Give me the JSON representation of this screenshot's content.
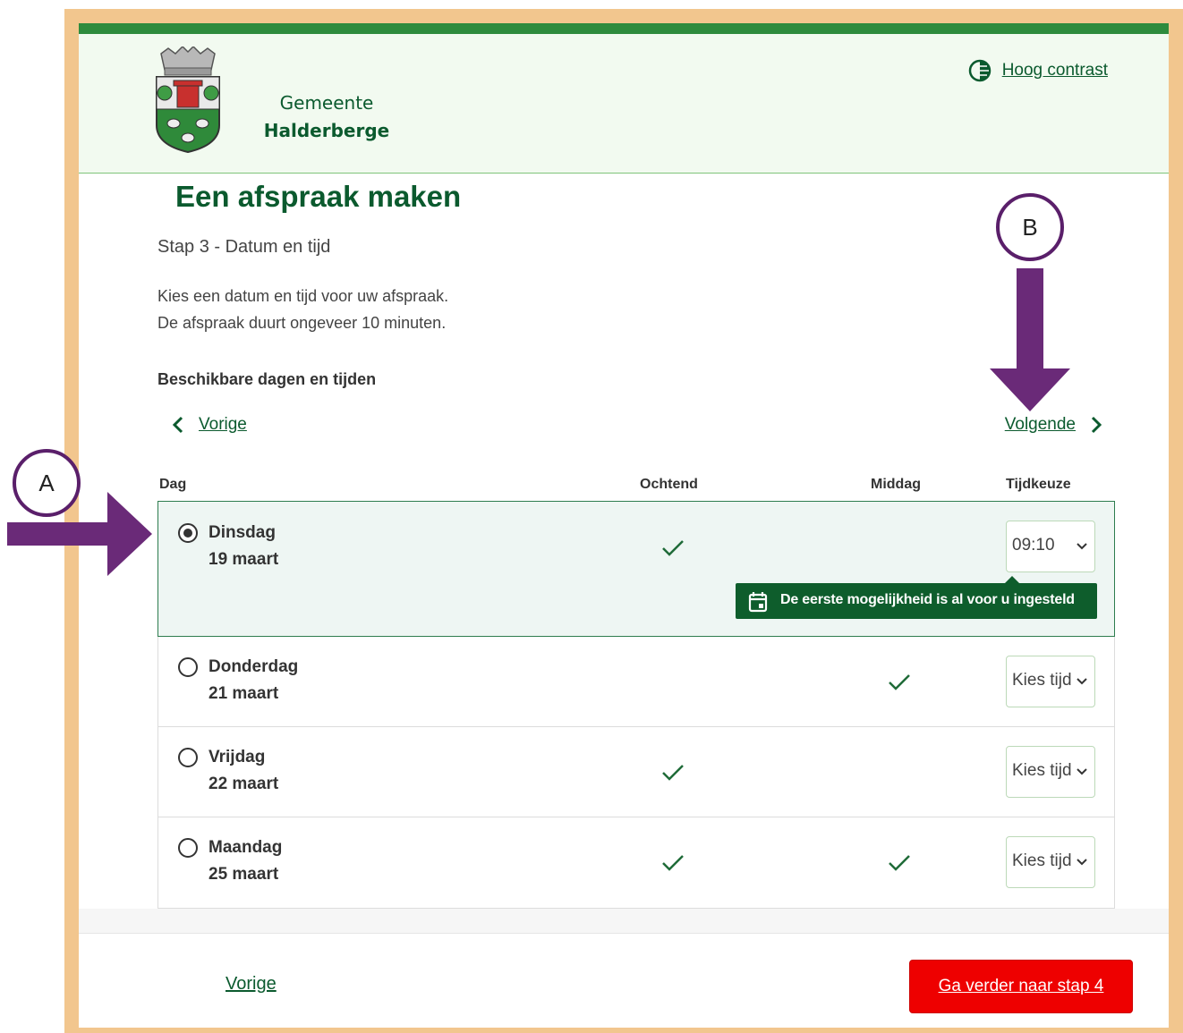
{
  "header": {
    "org_line1": "Gemeente",
    "org_line2": "Halderberge",
    "contrast_label": "Hoog contrast"
  },
  "page": {
    "title": "Een afspraak maken",
    "step": "Stap 3 - Datum en tijd",
    "intro_line1": "Kies een datum en tijd voor uw afspraak.",
    "intro_line2": "De afspraak duurt ongeveer 10 minuten.",
    "available_heading": "Beschikbare dagen en tijden"
  },
  "nav": {
    "previous": "Vorige",
    "next": "Volgende"
  },
  "table": {
    "columns": [
      "Dag",
      "Ochtend",
      "Middag",
      "Tijdkeuze"
    ],
    "rows": [
      {
        "day": "Dinsdag",
        "date": "19 maart",
        "morning": true,
        "afternoon": false,
        "time": "09:10",
        "selected": true
      },
      {
        "day": "Donderdag",
        "date": "21 maart",
        "morning": false,
        "afternoon": true,
        "time": "Kies tijd",
        "selected": false
      },
      {
        "day": "Vrijdag",
        "date": "22 maart",
        "morning": true,
        "afternoon": false,
        "time": "Kies tijd",
        "selected": false
      },
      {
        "day": "Maandag",
        "date": "25 maart",
        "morning": true,
        "afternoon": true,
        "time": "Kies tijd",
        "selected": false
      }
    ],
    "tooltip": "De eerste mogelijkheid is al voor u ingesteld"
  },
  "footer": {
    "previous": "Vorige",
    "continue": "Ga verder naar stap 4"
  },
  "annotations": {
    "a": "A",
    "b": "B"
  },
  "colors": {
    "brand_green": "#0b5a2e",
    "accent_green": "#2e8b3d",
    "cta_red": "#ee0000",
    "frame_orange": "#f2c68e",
    "annotation_purple": "#5a1f6a"
  }
}
